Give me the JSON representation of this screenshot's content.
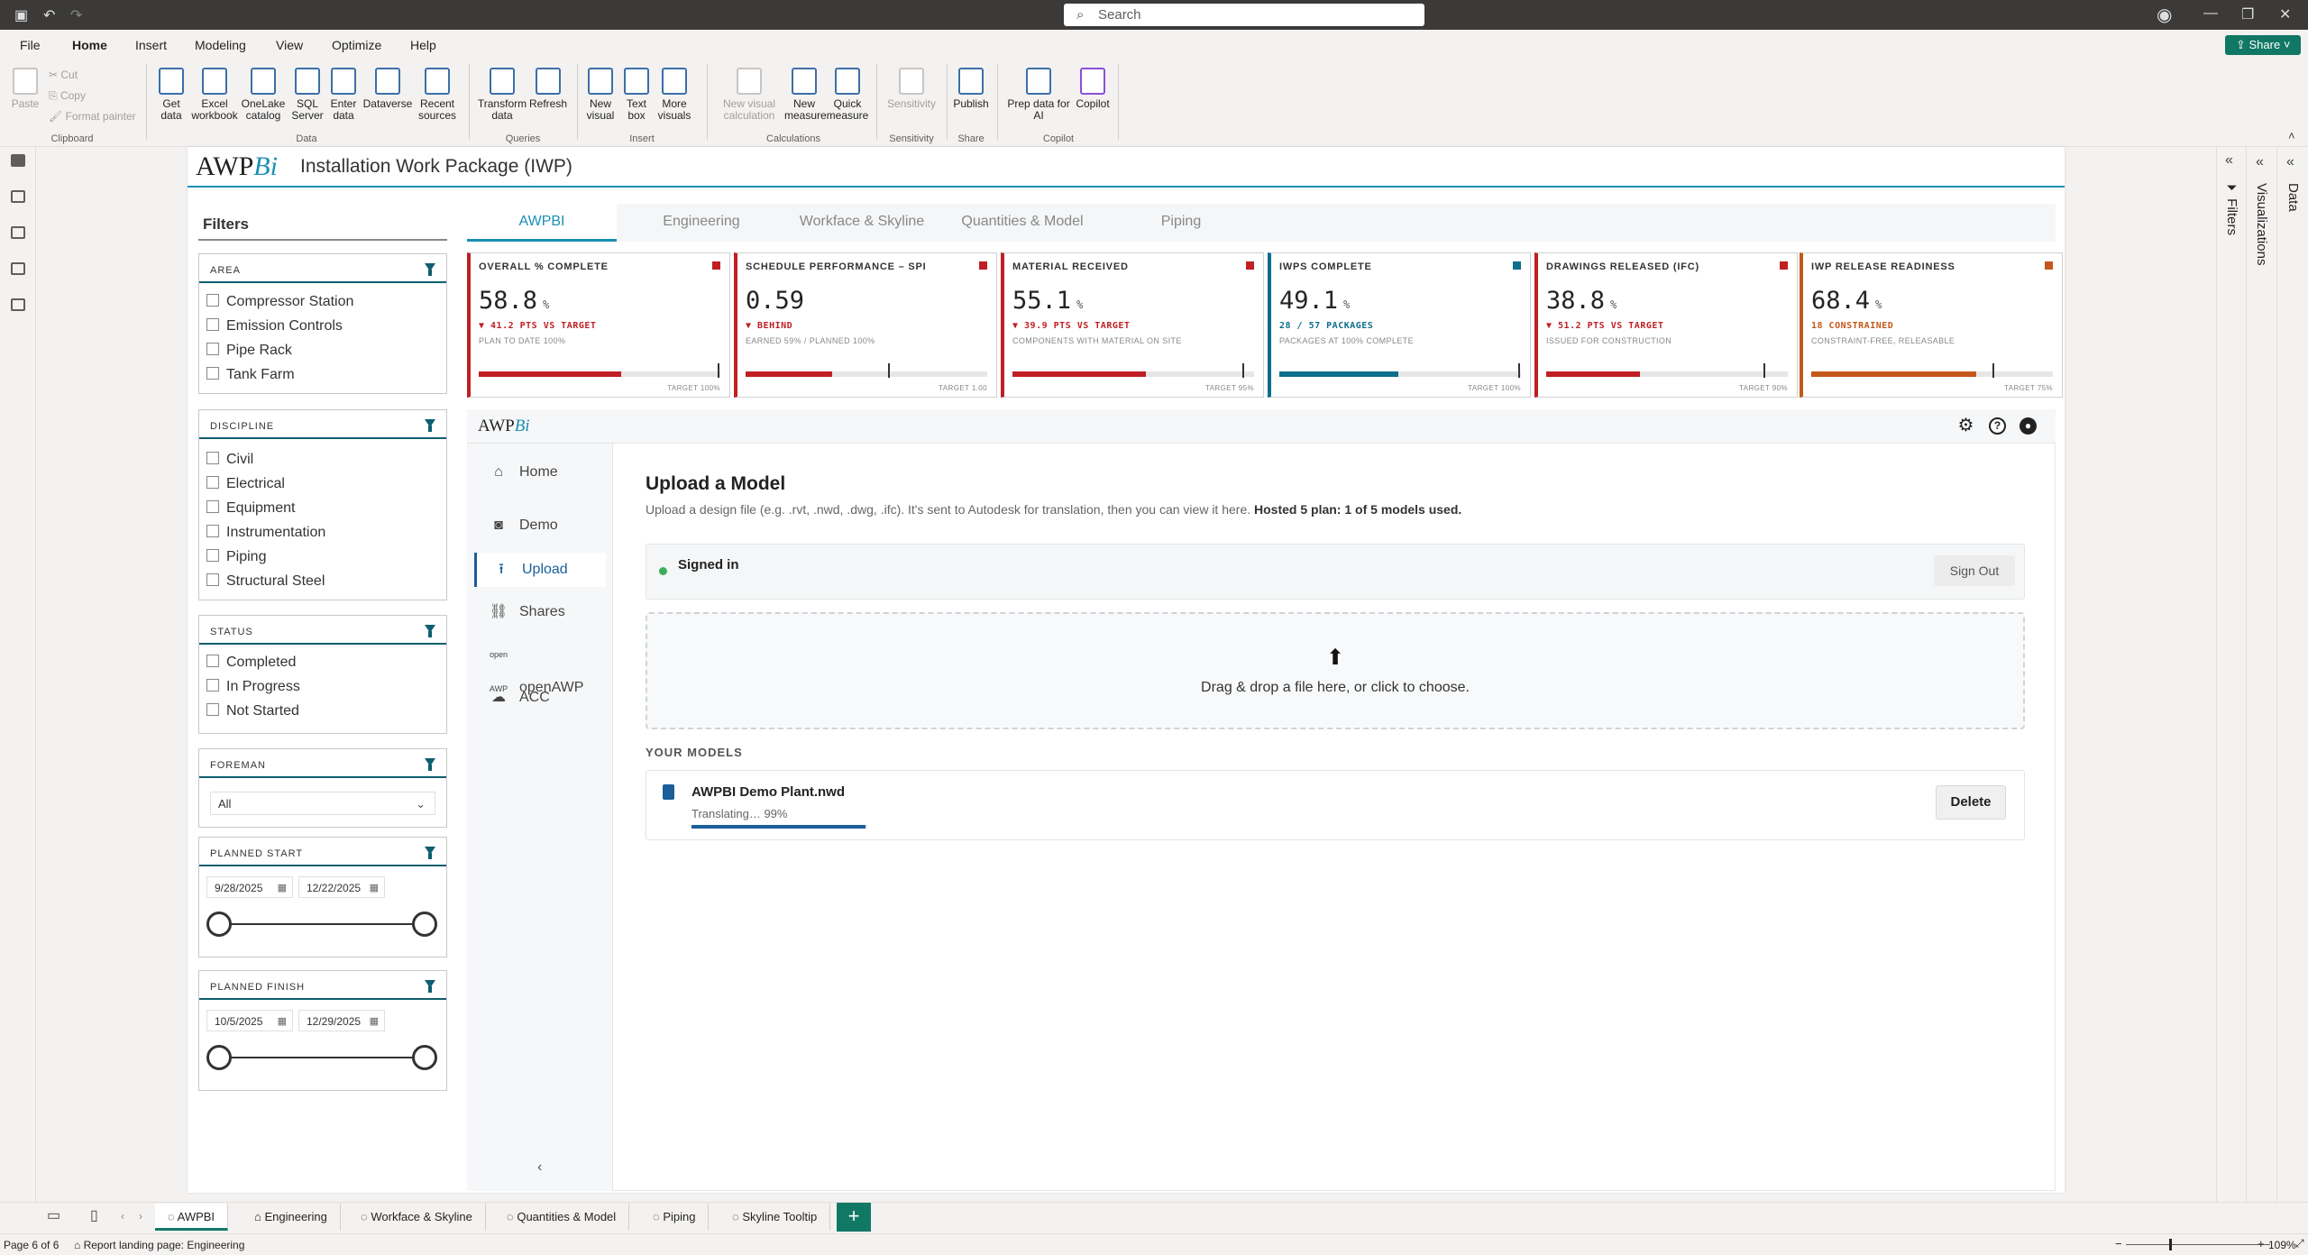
{
  "titlebar": {
    "search_placeholder": "Search"
  },
  "menu": {
    "file": "File",
    "home": "Home",
    "insert": "Insert",
    "modeling": "Modeling",
    "view": "View",
    "optimize": "Optimize",
    "help": "Help",
    "share": "Share"
  },
  "ribbon": {
    "paste": "Paste",
    "cut": "Cut",
    "copy": "Copy",
    "format_painter": "Format painter",
    "g_clipboard": "Clipboard",
    "get_data": "Get data",
    "excel": "Excel workbook",
    "onelake": "OneLake catalog",
    "sql": "SQL Server",
    "enter_data": "Enter data",
    "dataverse": "Dataverse",
    "recent": "Recent sources",
    "g_data": "Data",
    "transform": "Transform data",
    "refresh": "Refresh",
    "g_queries": "Queries",
    "new_visual": "New visual",
    "text_box": "Text box",
    "more_visuals": "More visuals",
    "g_insert": "Insert",
    "new_visual_calc": "New visual calculation",
    "new_measure": "New measure",
    "quick_measure": "Quick measure",
    "g_calc": "Calculations",
    "sensitivity": "Sensitivity",
    "g_sens": "Sensitivity",
    "publish": "Publish",
    "g_share": "Share",
    "prep_ai": "Prep data for AI",
    "copilot": "Copilot",
    "g_copilot": "Copilot"
  },
  "report": {
    "logo_a": "AWP",
    "logo_b": "Bi",
    "title": "Installation Work Package (IWP)"
  },
  "filters": {
    "heading": "Filters",
    "area": {
      "label": "AREA",
      "items": [
        "Compressor Station",
        "Emission Controls",
        "Pipe Rack",
        "Tank Farm"
      ]
    },
    "discipline": {
      "label": "DISCIPLINE",
      "items": [
        "Civil",
        "Electrical",
        "Equipment",
        "Instrumentation",
        "Piping",
        "Structural Steel"
      ]
    },
    "status": {
      "label": "STATUS",
      "items": [
        "Completed",
        "In Progress",
        "Not Started"
      ]
    },
    "foreman": {
      "label": "FOREMAN",
      "value": "All"
    },
    "planned_start": {
      "label": "PLANNED START",
      "from": "9/28/2025",
      "to": "12/22/2025"
    },
    "planned_finish": {
      "label": "PLANNED FINISH",
      "from": "10/5/2025",
      "to": "12/29/2025"
    }
  },
  "tabs": [
    "AWPBI",
    "Engineering",
    "Workface & Skyline",
    "Quantities & Model",
    "Piping"
  ],
  "kpis": [
    {
      "label": "OVERALL % COMPLETE",
      "value": "58.8",
      "unit": "%",
      "delta": "▼ 41.2 PTS VS TARGET",
      "sub": "PLAN TO DATE 100%",
      "target": "TARGET 100%",
      "fill": 0.588,
      "tick": 0.99,
      "color": "#c01f24"
    },
    {
      "label": "SCHEDULE PERFORMANCE – SPI",
      "value": "0.59",
      "unit": "",
      "delta": "▼ BEHIND",
      "sub": "EARNED 59% / PLANNED 100%",
      "target": "TARGET 1.00",
      "fill": 0.36,
      "tick": 0.59,
      "color": "#c01f24"
    },
    {
      "label": "MATERIAL RECEIVED",
      "value": "55.1",
      "unit": "%",
      "delta": "▼ 39.9 PTS VS TARGET",
      "sub": "COMPONENTS WITH MATERIAL ON SITE",
      "target": "TARGET 95%",
      "fill": 0.551,
      "tick": 0.95,
      "color": "#c01f24"
    },
    {
      "label": "IWPS COMPLETE",
      "value": "49.1",
      "unit": "%",
      "delta": "28 / 57 PACKAGES",
      "sub": "PACKAGES AT 100% COMPLETE",
      "target": "TARGET 100%",
      "fill": 0.491,
      "tick": 0.99,
      "color": "#0e6e8c"
    },
    {
      "label": "DRAWINGS RELEASED (IFC)",
      "value": "38.8",
      "unit": "%",
      "delta": "▼ 51.2 PTS VS TARGET",
      "sub": "ISSUED FOR CONSTRUCTION",
      "target": "TARGET 90%",
      "fill": 0.388,
      "tick": 0.9,
      "color": "#c01f24"
    },
    {
      "label": "IWP RELEASE READINESS",
      "value": "68.4",
      "unit": "%",
      "delta": "18 CONSTRAINED",
      "sub": "CONSTRAINT-FREE, RELEASABLE",
      "target": "TARGET 75%",
      "fill": 0.684,
      "tick": 0.75,
      "color": "#c4581a"
    }
  ],
  "app": {
    "logo_a": "AWP",
    "logo_b": "Bi",
    "nav": [
      "Home",
      "Demo",
      "Upload",
      "Shares",
      "openAWP",
      "ACC"
    ],
    "heading": "Upload a Model",
    "desc": "Upload a design file (e.g. .rvt, .nwd, .dwg, .ifc). It's sent to Autodesk for translation, then you can view it here.",
    "plan": "Hosted 5 plan: 1 of 5 models used.",
    "signed_in": "Signed in",
    "sign_out": "Sign Out",
    "drop_text": "Drag & drop a file here, or click to choose.",
    "your_models": "YOUR MODELS",
    "model_name": "AWPBI Demo Plant.nwd",
    "model_status": "Translating… 99%",
    "model_progress": 0.99,
    "delete": "Delete"
  },
  "panes": {
    "filters": "Filters",
    "visualizations": "Visualizations",
    "data": "Data"
  },
  "pages": [
    "AWPBI",
    "Engineering",
    "Workface & Skyline",
    "Quantities & Model",
    "Piping",
    "Skyline Tooltip"
  ],
  "status": {
    "page": "Page 6 of 6",
    "landing": "Report landing page: Engineering",
    "zoom": "109%"
  }
}
